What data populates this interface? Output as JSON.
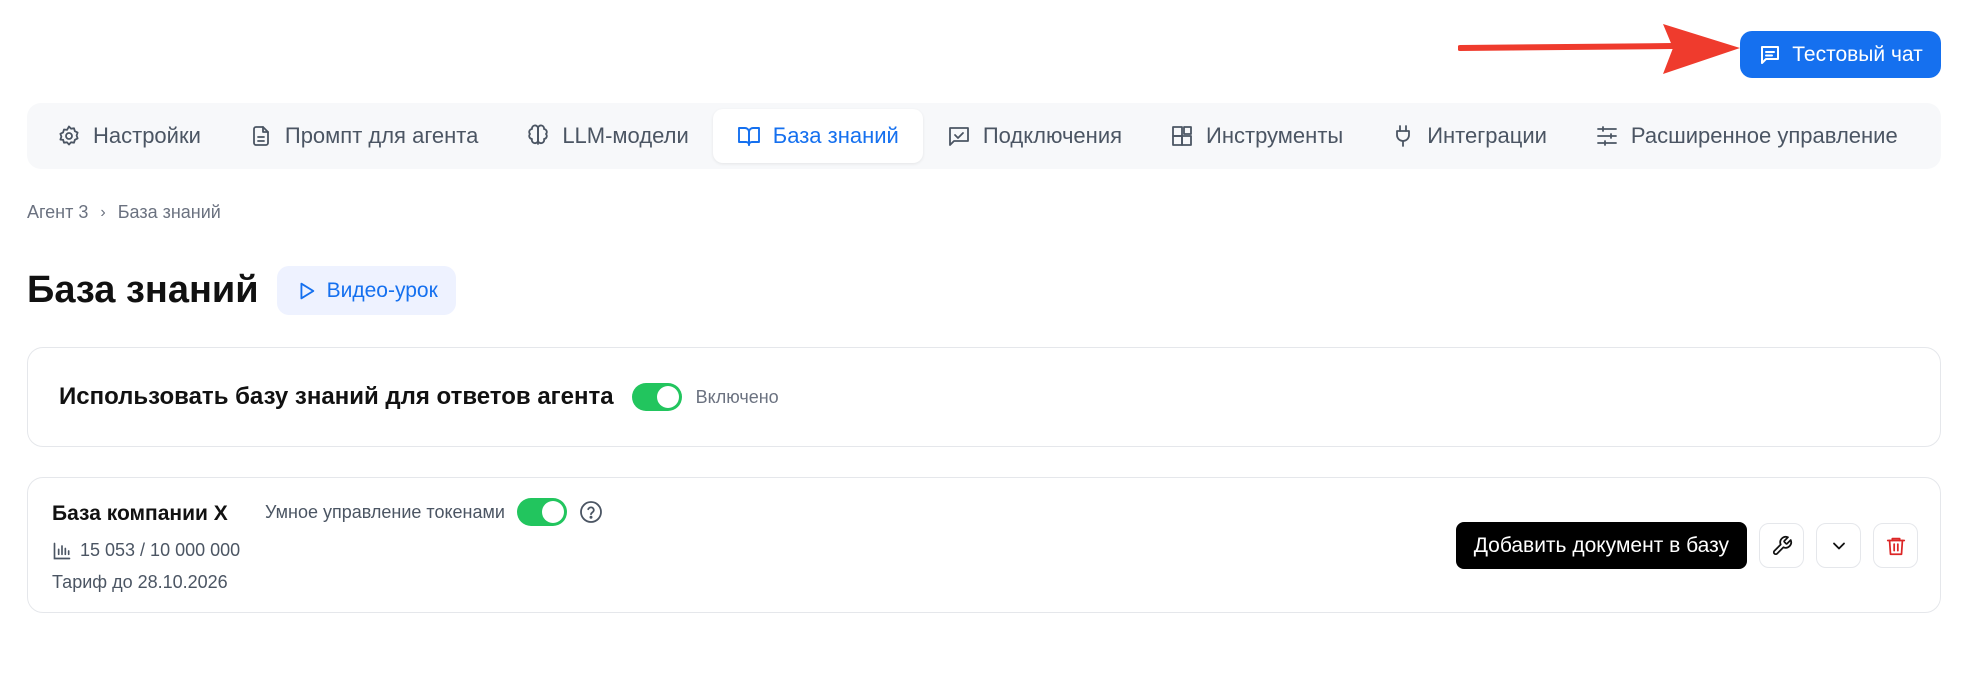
{
  "header": {
    "test_chat_label": "Тестовый чат"
  },
  "tabs": [
    {
      "label": "Настройки",
      "icon": "gear-icon",
      "active": false
    },
    {
      "label": "Промпт для агента",
      "icon": "document-icon",
      "active": false
    },
    {
      "label": "LLM-модели",
      "icon": "brain-icon",
      "active": false
    },
    {
      "label": "База знаний",
      "icon": "book-icon",
      "active": true
    },
    {
      "label": "Подключения",
      "icon": "message-check-icon",
      "active": false
    },
    {
      "label": "Инструменты",
      "icon": "blocks-icon",
      "active": false
    },
    {
      "label": "Интеграции",
      "icon": "plug-icon",
      "active": false
    },
    {
      "label": "Расширенное управление",
      "icon": "sliders-icon",
      "active": false
    }
  ],
  "breadcrumb": {
    "items": [
      "Агент 3",
      "База знаний"
    ],
    "separator": "›"
  },
  "page": {
    "title": "База знаний",
    "video_label": "Видео-урок"
  },
  "kb_toggle": {
    "title": "Использовать базу знаний для ответов агента",
    "enabled": true,
    "status_label": "Включено"
  },
  "base": {
    "name": "База компании X",
    "smart_tokens_label": "Умное управление токенами",
    "smart_tokens_enabled": true,
    "usage": "15 053 / 10 000 000",
    "tariff": "Тариф до 28.10.2026",
    "add_document_label": "Добавить документ в базу"
  },
  "colors": {
    "accent": "#1570ef",
    "toggle_on": "#22c55e",
    "danger": "#dc2626",
    "annotation_arrow": "#ef3b2d"
  }
}
